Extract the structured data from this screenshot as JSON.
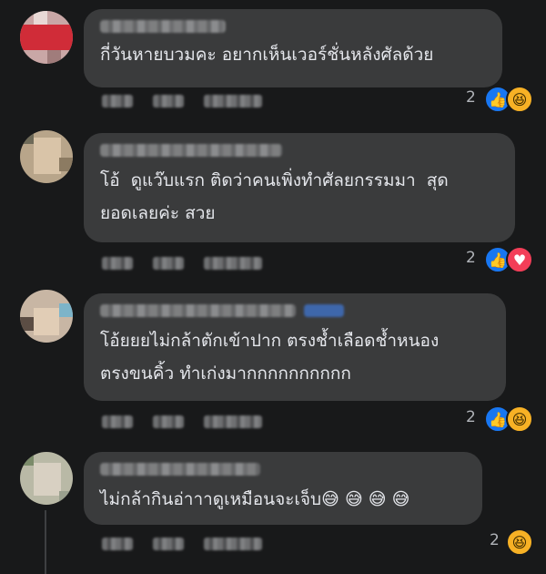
{
  "comments": [
    {
      "text": "กี่วันหายบวมคะ อยากเห็นเวอร์ชั่นหลังศัลด้วย",
      "reaction_count": "2",
      "reactions": [
        "like-icon",
        "haha-icon"
      ]
    },
    {
      "text": "โอ้  ดูแว๊บแรก ติดว่าคนเพิ่งทำศัลยกรรมมา  สุด\nยอดเลยค่ะ สวย",
      "reaction_count": "2",
      "reactions": [
        "like-icon",
        "love-icon"
      ]
    },
    {
      "text": "โอ้ยยยไม่กล้าตักเข้าปาก ตรงช้ำเลือดช้ำหนอง\nตรงขนคิ้ว ทำเก่งมากกกกกกกกกก",
      "reaction_count": "2",
      "reactions": [
        "like-icon",
        "haha-icon"
      ]
    },
    {
      "text": "ไม่กล้ากินอ่าาาดูเหมือนจะเจ็บ😅 😅 😅 😅",
      "reaction_count": "2",
      "reactions": [
        "haha-icon"
      ]
    }
  ],
  "icons": {
    "like": "👍",
    "haha": "😆",
    "love": "♥"
  },
  "colors": {
    "background": "#18191a",
    "bubble": "#3a3b3c",
    "text": "#e4e6eb",
    "like": "#1877f2",
    "haha": "#f7b125",
    "love": "#f33e58"
  }
}
